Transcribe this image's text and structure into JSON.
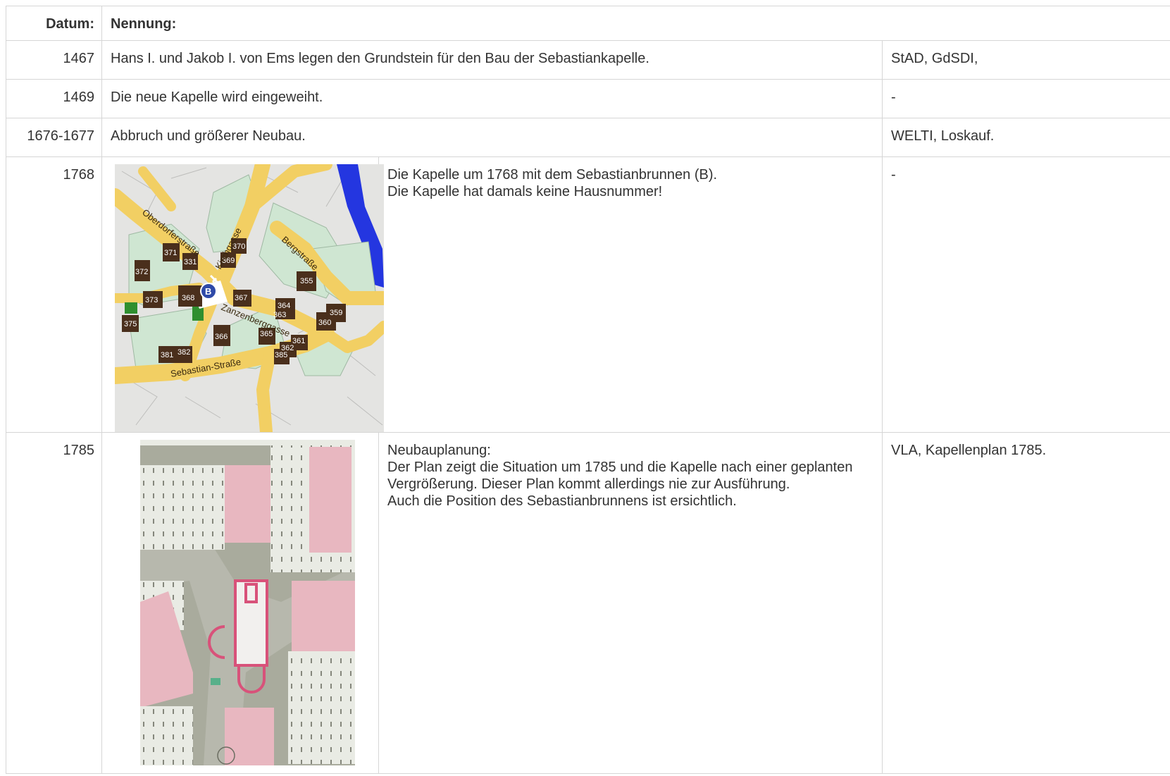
{
  "table": {
    "header": {
      "date": "Datum:",
      "mention": "Nennung:"
    },
    "rows": [
      {
        "date": "1467",
        "text": "Hans I. und Jakob I. von Ems legen den  Grundstein für den Bau der Sebastiankapelle.",
        "source": "StAD, GdSDI,"
      },
      {
        "date": "1469",
        "text": "Die neue Kapelle wird eingeweiht.",
        "source": "-"
      },
      {
        "date": "1676-1677",
        "text": "Abbruch und größerer Neubau.",
        "source": "WELTI, Loskauf."
      },
      {
        "date": "1768",
        "lines": [
          "Die Kapelle um 1768 mit dem Sebastianbrunnen (B).",
          "Die Kapelle hat damals keine Hausnummer!"
        ],
        "source": "-",
        "map": {
          "streets": [
            "Oberdorferstraße",
            "Kirchgasse",
            "Bergstraße",
            "Zanzenberggasse",
            "Sebastian-Straße"
          ],
          "house_numbers": [
            "371",
            "331",
            "370",
            "369",
            "372",
            "373",
            "368",
            "367",
            "355",
            "364",
            "363",
            "359",
            "360",
            "375",
            "366",
            "365",
            "361",
            "362",
            "385",
            "381",
            "382"
          ],
          "fountain_label": "B",
          "colors": {
            "street": "#f2cf63",
            "garden": "#cfe6d2",
            "house": "#4a2f1c",
            "fountain": "#2f4aa8",
            "river": "#2436e0",
            "green": "#2f8f2f"
          }
        }
      },
      {
        "date": "1785",
        "lines": [
          "Neubauplanung:",
          "Der Plan zeigt die Situation um 1785  und die Kapelle nach einer geplanten Vergrößerung. Dieser Plan kommt allerdings nie zur Ausführung.",
          "Auch die Position des Sebastianbrunnens ist ersichtlich."
        ],
        "source": "VLA, Kapellenplan 1785.",
        "plan": {
          "colors": {
            "paper": "#a9ab9d",
            "road": "#b7b8ad",
            "pink": "#e8b7c0",
            "orchard": "#e9ebe4",
            "chapel": "#d8527a"
          }
        }
      }
    ]
  }
}
